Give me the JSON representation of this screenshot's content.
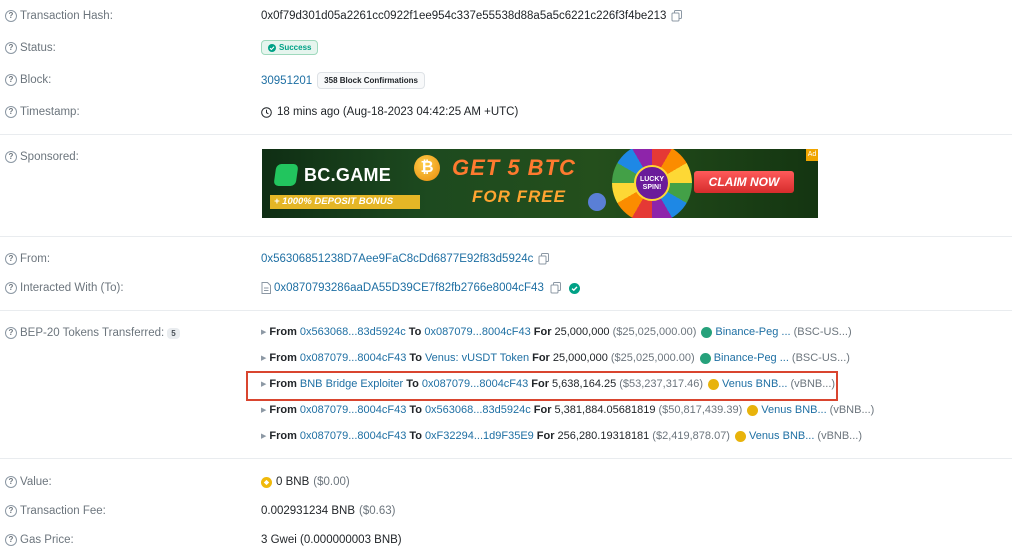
{
  "fields": {
    "tx_hash_label": "Transaction Hash:",
    "tx_hash_value": "0x0f79d301d05a2261cc0922f1ee954c337e55538d88a5a5c6221c226f3f4be213",
    "status_label": "Status:",
    "status_value": "Success",
    "block_label": "Block:",
    "block_value": "30951201",
    "block_confirmations": "358 Block Confirmations",
    "timestamp_label": "Timestamp:",
    "timestamp_value": "18 mins ago (Aug-18-2023 04:42:25 AM +UTC)",
    "sponsored_label": "Sponsored:",
    "from_label": "From:",
    "from_value": "0x56306851238D7Aee9FaC8cDd6877E92f83d5924c",
    "interacted_label": "Interacted With (To):",
    "interacted_value": "0x0870793286aaDA55D39CE7f82fb2766e8004cF43",
    "bep20_label": "BEP-20 Tokens Transferred:",
    "bep20_count": "5",
    "value_label": "Value:",
    "value_value": "0 BNB",
    "value_usd": "($0.00)",
    "fee_label": "Transaction Fee:",
    "fee_value": "0.002931234 BNB",
    "fee_usd": "($0.63)",
    "gas_label": "Gas Price:",
    "gas_value": "3 Gwei (0.000000003 BNB)"
  },
  "banner": {
    "brand": "BC.GAME",
    "bonus": "+ 1000% DEPOSIT BONUS",
    "headline_1": "GET 5 BTC",
    "headline_2": "FOR FREE",
    "wheel_text_1": "LUCKY",
    "wheel_text_2": "SPIN!",
    "cta": "CLAIM NOW",
    "corner": "Ad"
  },
  "transfers": [
    {
      "from_word": "From",
      "from": "0x563068...83d5924c",
      "to_word": "To",
      "to": "0x087079...8004cF43",
      "for_word": "For",
      "amount": "25,000,000",
      "usd": "($25,025,000.00)",
      "token": "Binance-Peg ...",
      "token_symbol": "(BSC-US...)",
      "token_color": "#26a17b"
    },
    {
      "from_word": "From",
      "from": "0x087079...8004cF43",
      "to_word": "To",
      "to": "Venus: vUSDT Token",
      "for_word": "For",
      "amount": "25,000,000",
      "usd": "($25,025,000.00)",
      "token": "Binance-Peg ...",
      "token_symbol": "(BSC-US...)",
      "token_color": "#26a17b"
    },
    {
      "from_word": "From",
      "from": "BNB Bridge Exploiter",
      "to_word": "To",
      "to": "0x087079...8004cF43",
      "for_word": "For",
      "amount": "5,638,164.25",
      "usd": "($53,237,317.46)",
      "token": "Venus BNB...",
      "token_symbol": "(vBNB...)",
      "token_color": "#e8b30b"
    },
    {
      "from_word": "From",
      "from": "0x087079...8004cF43",
      "to_word": "To",
      "to": "0x563068...83d5924c",
      "for_word": "For",
      "amount": "5,381,884.05681819",
      "usd": "($50,817,439.39)",
      "token": "Venus BNB...",
      "token_symbol": "(vBNB...)",
      "token_color": "#e8b30b"
    },
    {
      "from_word": "From",
      "from": "0x087079...8004cF43",
      "to_word": "To",
      "to": "0xF32294...1d9F35E9",
      "for_word": "For",
      "amount": "256,280.19318181",
      "usd": "($2,419,878.07)",
      "token": "Venus BNB...",
      "token_symbol": "(vBNB...)",
      "token_color": "#e8b30b"
    }
  ],
  "colors": {
    "link": "#1e6fa3",
    "success": "#00a186",
    "highlight": "#d9452f",
    "bnb": "#f0b90b"
  }
}
